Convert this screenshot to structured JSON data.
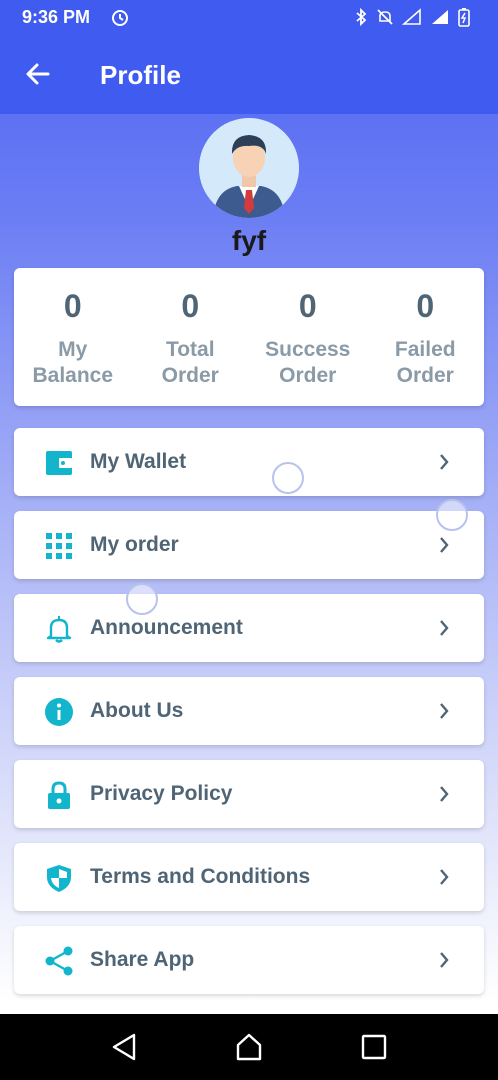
{
  "status": {
    "time": "9:36 PM"
  },
  "header": {
    "title": "Profile"
  },
  "profile": {
    "name": "fyf"
  },
  "stats": [
    {
      "value": "0",
      "label": "My\nBalance"
    },
    {
      "value": "0",
      "label": "Total\nOrder"
    },
    {
      "value": "0",
      "label": "Success\nOrder"
    },
    {
      "value": "0",
      "label": "Failed\nOrder"
    }
  ],
  "menu": [
    {
      "label": "My Wallet",
      "icon": "wallet-icon"
    },
    {
      "label": "My order",
      "icon": "grid-icon"
    },
    {
      "label": "Announcement",
      "icon": "bell-icon"
    },
    {
      "label": "About Us",
      "icon": "info-icon"
    },
    {
      "label": "Privacy Policy",
      "icon": "lock-icon"
    },
    {
      "label": "Terms and Conditions",
      "icon": "shield-icon"
    },
    {
      "label": "Share App",
      "icon": "share-icon"
    }
  ],
  "colors": {
    "primary": "#3f5bf0",
    "accent": "#12b5cb",
    "text": "#4f6576"
  }
}
